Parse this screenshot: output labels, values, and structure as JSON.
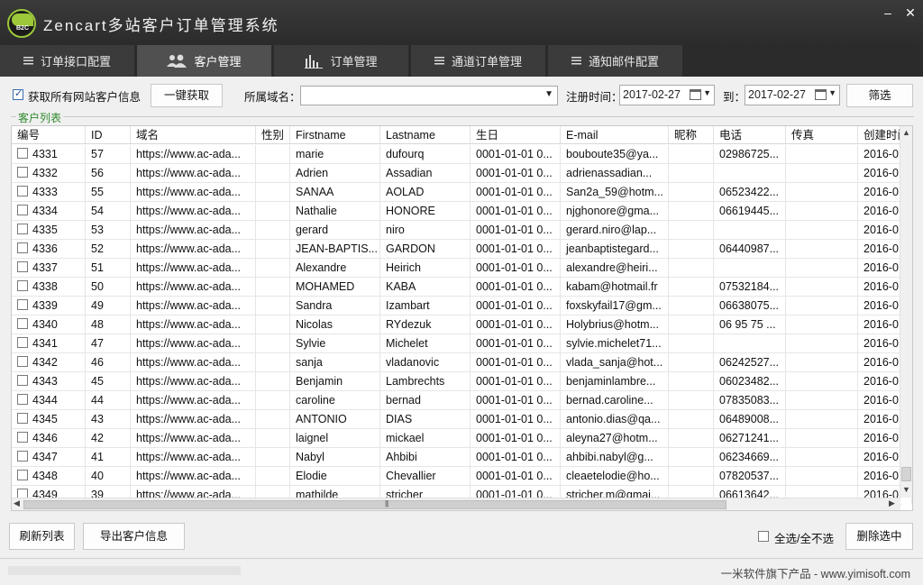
{
  "app": {
    "title": "Zencart多站客户订单管理系统",
    "logo_text": "B2C"
  },
  "window": {
    "minimize": "–",
    "close": "✕"
  },
  "tabs": [
    {
      "label": "订单接口配置",
      "icon": "list-icon",
      "active": false
    },
    {
      "label": "客户管理",
      "icon": "users-icon",
      "active": true
    },
    {
      "label": "订单管理",
      "icon": "bar-chart-icon",
      "active": false
    },
    {
      "label": "通道订单管理",
      "icon": "list-icon",
      "active": false
    },
    {
      "label": "通知邮件配置",
      "icon": "list-icon",
      "active": false
    }
  ],
  "toolbar": {
    "fetch_all_label": "获取所有网站客户信息",
    "fetch_all_checked": true,
    "one_click_button": "一键获取",
    "domain_label": "所属域名：",
    "domain_value": "",
    "reg_time_label": "注册时间：",
    "date_from": "2017-02-27",
    "to_label": "到：",
    "date_to": "2017-02-27",
    "filter_button": "筛选"
  },
  "group": {
    "title": "客户列表"
  },
  "grid": {
    "columns": [
      "编号",
      "ID",
      "域名",
      "性别",
      "Firstname",
      "Lastname",
      "生日",
      "E-mail",
      "昵称",
      "电话",
      "传真",
      "创建时间"
    ],
    "rows": [
      [
        "4331",
        "57",
        "https://www.ac-ada...",
        "",
        "marie",
        "dufourq",
        "0001-01-01 0...",
        "bouboute35@ya...",
        "",
        "02986725...",
        "",
        "2016-0"
      ],
      [
        "4332",
        "56",
        "https://www.ac-ada...",
        "",
        "Adrien",
        "Assadian",
        "0001-01-01 0...",
        "adrienassadian...",
        "",
        "",
        "",
        "2016-0"
      ],
      [
        "4333",
        "55",
        "https://www.ac-ada...",
        "",
        "SANAA",
        "AOLAD",
        "0001-01-01 0...",
        "San2a_59@hotm...",
        "",
        "06523422...",
        "",
        "2016-0"
      ],
      [
        "4334",
        "54",
        "https://www.ac-ada...",
        "",
        "Nathalie",
        "HONORE",
        "0001-01-01 0...",
        "njghonore@gma...",
        "",
        "06619445...",
        "",
        "2016-0"
      ],
      [
        "4335",
        "53",
        "https://www.ac-ada...",
        "",
        "gerard",
        "niro",
        "0001-01-01 0...",
        "gerard.niro@lap...",
        "",
        "",
        "",
        "2016-0"
      ],
      [
        "4336",
        "52",
        "https://www.ac-ada...",
        "",
        "JEAN-BAPTIS...",
        "GARDON",
        "0001-01-01 0...",
        "jeanbaptistegard...",
        "",
        "06440987...",
        "",
        "2016-0"
      ],
      [
        "4337",
        "51",
        "https://www.ac-ada...",
        "",
        "Alexandre",
        "Heirich",
        "0001-01-01 0...",
        "alexandre@heiri...",
        "",
        "",
        "",
        "2016-0"
      ],
      [
        "4338",
        "50",
        "https://www.ac-ada...",
        "",
        "MOHAMED",
        "KABA",
        "0001-01-01 0...",
        "kabam@hotmail.fr",
        "",
        "07532184...",
        "",
        "2016-0"
      ],
      [
        "4339",
        "49",
        "https://www.ac-ada...",
        "",
        "Sandra",
        "Izambart",
        "0001-01-01 0...",
        "foxskyfail17@gm...",
        "",
        "06638075...",
        "",
        "2016-0"
      ],
      [
        "4340",
        "48",
        "https://www.ac-ada...",
        "",
        "Nicolas",
        "RYdezuk",
        "0001-01-01 0...",
        "Holybrius@hotm...",
        "",
        "06 95 75 ...",
        "",
        "2016-0"
      ],
      [
        "4341",
        "47",
        "https://www.ac-ada...",
        "",
        "Sylvie",
        "Michelet",
        "0001-01-01 0...",
        "sylvie.michelet71...",
        "",
        "",
        "",
        "2016-0"
      ],
      [
        "4342",
        "46",
        "https://www.ac-ada...",
        "",
        "sanja",
        "vladanovic",
        "0001-01-01 0...",
        "vlada_sanja@hot...",
        "",
        "06242527...",
        "",
        "2016-0"
      ],
      [
        "4343",
        "45",
        "https://www.ac-ada...",
        "",
        "Benjamin",
        "Lambrechts",
        "0001-01-01 0...",
        "benjaminlambre...",
        "",
        "06023482...",
        "",
        "2016-0"
      ],
      [
        "4344",
        "44",
        "https://www.ac-ada...",
        "",
        "caroline",
        "bernad",
        "0001-01-01 0...",
        "bernad.caroline...",
        "",
        "07835083...",
        "",
        "2016-0"
      ],
      [
        "4345",
        "43",
        "https://www.ac-ada...",
        "",
        "ANTONIO",
        "DIAS",
        "0001-01-01 0...",
        "antonio.dias@qa...",
        "",
        "06489008...",
        "",
        "2016-0"
      ],
      [
        "4346",
        "42",
        "https://www.ac-ada...",
        "",
        "laignel",
        "mickael",
        "0001-01-01 0...",
        "aleyna27@hotm...",
        "",
        "06271241...",
        "",
        "2016-0"
      ],
      [
        "4347",
        "41",
        "https://www.ac-ada...",
        "",
        "Nabyl",
        "Ahbibi",
        "0001-01-01 0...",
        "ahbibi.nabyl@g...",
        "",
        "06234669...",
        "",
        "2016-0"
      ],
      [
        "4348",
        "40",
        "https://www.ac-ada...",
        "",
        "Elodie",
        "Chevallier",
        "0001-01-01 0...",
        "cleaetelodie@ho...",
        "",
        "07820537...",
        "",
        "2016-0"
      ],
      [
        "4349",
        "39",
        "https://www.ac-ada...",
        "",
        "mathilde",
        "stricher",
        "0001-01-01 0...",
        "stricher.m@gmai...",
        "",
        "06613642...",
        "",
        "2016-0"
      ]
    ]
  },
  "bottom": {
    "refresh_button": "刷新列表",
    "export_button": "导出客户信息",
    "select_all_label": "全选/全不选",
    "delete_button": "删除选中",
    "footer_text": "一米软件旗下产品 - www.yimisoft.com"
  },
  "colors": {
    "titlebar": "#2b2b2b",
    "tab_active": "#505050",
    "group_title": "#2f8a2f",
    "logo_accent": "#9cc83a"
  }
}
